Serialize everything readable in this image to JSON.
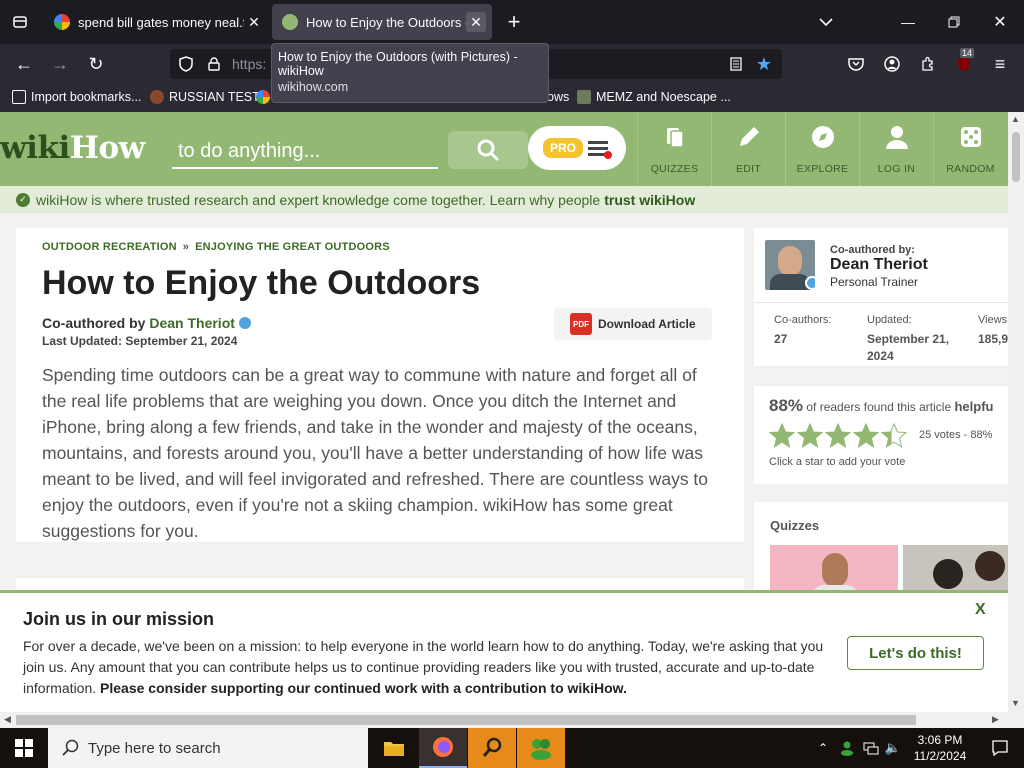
{
  "browser": {
    "tabs": [
      {
        "title": "spend bill gates money neal.fun",
        "active": false
      },
      {
        "title": "How to Enjoy the Outdoors (with Pictures) - wikiHow",
        "active": true
      }
    ],
    "tooltip": {
      "title": "How to Enjoy the Outdoors (with Pictures) - wikiHow",
      "url": "wikihow.com"
    },
    "url_visible": "https:",
    "extension_badge": "14",
    "bookmarks": [
      "Import bookmarks...",
      "RUSSIAN TEST",
      "ows",
      "MEMZ and Noescape ..."
    ]
  },
  "site": {
    "logo_part1": "wiki",
    "logo_part2": "How",
    "search_placeholder": "to do anything...",
    "pro_label": "PRO",
    "nav": [
      "QUIZZES",
      "EDIT",
      "EXPLORE",
      "LOG IN",
      "RANDOM"
    ],
    "trust_text": "wikiHow is where trusted research and expert knowledge come together. Learn why people",
    "trust_link": "trust wikiHow"
  },
  "article": {
    "breadcrumb": [
      "OUTDOOR RECREATION",
      "ENJOYING THE GREAT OUTDOORS"
    ],
    "breadcrumb_sep": "»",
    "title": "How to Enjoy the Outdoors",
    "coauthored_prefix": "Co-authored by",
    "author": "Dean Theriot",
    "updated": "Last Updated: September 21, 2024",
    "download_label": "Download Article",
    "pdf_label": "PDF",
    "intro": "Spending time outdoors can be a great way to commune with nature and forget all of the real life problems that are weighing you down. Once you ditch the Internet and iPhone, bring along a few friends, and take in the wonder and majesty of the oceans, mountains, and forests around you, you'll have a better understanding of how life was meant to be lived, and will feel invigorated and refreshed. There are countless ways to enjoy the outdoors, even if you're not a skiing champion. wikiHow has some great suggestions for you."
  },
  "sidebar": {
    "coauthored_by": "Co-authored by:",
    "name": "Dean Theriot",
    "role": "Personal Trainer",
    "stats": [
      {
        "label": "Co-authors:",
        "value": "27"
      },
      {
        "label": "Updated:",
        "value": "September 21, 2024"
      },
      {
        "label": "Views",
        "value": "185,9"
      }
    ],
    "rating": {
      "percent": "88%",
      "text": "of readers found this article",
      "helpful": "helpfu",
      "votes": "25 votes - 88%",
      "hint": "Click a star to add your vote",
      "stars": 4.4
    },
    "quizzes_title": "Quizzes"
  },
  "mission": {
    "title": "Join us in our mission",
    "text": "For over a decade, we've been on a mission: to help everyone in the world learn how to do anything. Today, we're asking that you join us. Any amount that you can contribute helps us to continue providing readers like you with trusted, accurate and up-to-date information.",
    "bold": "Please consider supporting our continued work with a contribution to wikiHow.",
    "button": "Let's do this!",
    "close": "X"
  },
  "taskbar": {
    "search_placeholder": "Type here to search",
    "time": "3:06 PM",
    "date": "11/2/2024"
  },
  "colors": {
    "brand_green": "#93b874",
    "dark_green": "#3d6b27",
    "star": "#93b874"
  }
}
